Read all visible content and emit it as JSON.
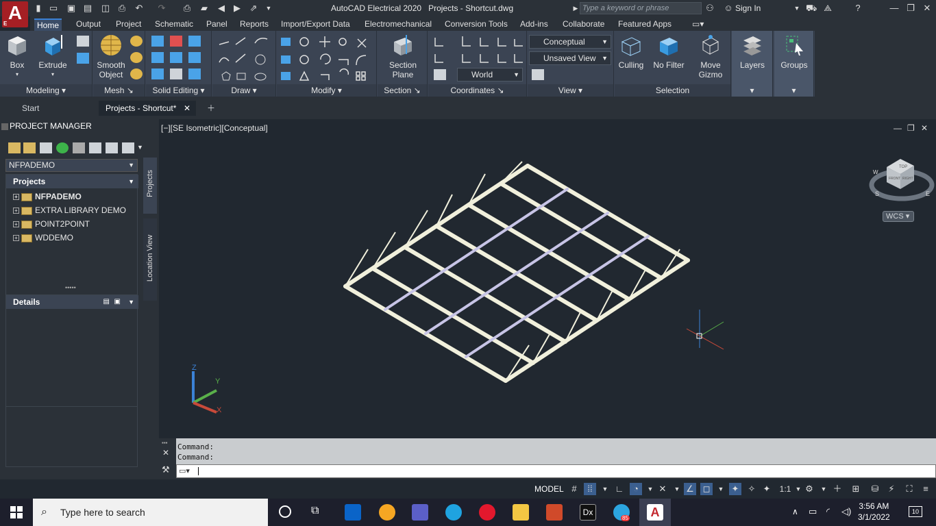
{
  "app": {
    "title": "AutoCAD Electrical 2020",
    "document": "Projects - Shortcut.dwg",
    "logo_letter": "A",
    "logo_sub": "E",
    "search_placeholder": "Type a keyword or phrase",
    "sign_in": "Sign In"
  },
  "ribbon_tabs": [
    "Home",
    "Output",
    "Project",
    "Schematic",
    "Panel",
    "Reports",
    "Import/Export Data",
    "Electromechanical",
    "Conversion Tools",
    "Add-ins",
    "Collaborate",
    "Featured Apps"
  ],
  "ribbon": {
    "box": "Box",
    "extrude": "Extrude",
    "smooth_1": "Smooth",
    "smooth_2": "Object",
    "section_1": "Section",
    "section_2": "Plane",
    "visual_style": "Conceptual",
    "saved_view": "Unsaved View",
    "ucs": "World",
    "culling": "Culling",
    "no_filter": "No Filter",
    "move_1": "Move",
    "move_2": "Gizmo",
    "layers": "Layers",
    "groups": "Groups",
    "panels": [
      "Modeling",
      "Mesh",
      "Solid Editing",
      "Draw",
      "Modify",
      "Section",
      "Coordinates",
      "View",
      "Selection"
    ]
  },
  "file_tabs": [
    "Start",
    "Projects - Shortcut*"
  ],
  "project_manager": {
    "title": "PROJECT MANAGER",
    "current": "NFPADEMO",
    "projects_header": "Projects",
    "projects": [
      "NFPADEMO",
      "EXTRA LIBRARY DEMO",
      "POINT2POINT",
      "WDDEMO"
    ],
    "details_header": "Details",
    "tab_projects": "Projects",
    "tab_location": "Location View"
  },
  "viewport": {
    "label": "[−][SE Isometric][Conceptual]",
    "wcs": "WCS",
    "cube_top": "TOP",
    "cube_left": "FRONT",
    "cube_right": "RIGHT",
    "compass_s": "S",
    "compass_e": "E",
    "compass_w": "W"
  },
  "command": {
    "line1": "Command:",
    "line2": "Command:"
  },
  "status": {
    "model": "MODEL",
    "scale": "1:1"
  },
  "taskbar": {
    "search": "Type here to search",
    "time": "3:56 AM",
    "date": "3/1/2022",
    "badge": "85",
    "notif": "10"
  },
  "colors": {
    "accent": "#3b82d6",
    "autocad_red": "#a51f24"
  }
}
